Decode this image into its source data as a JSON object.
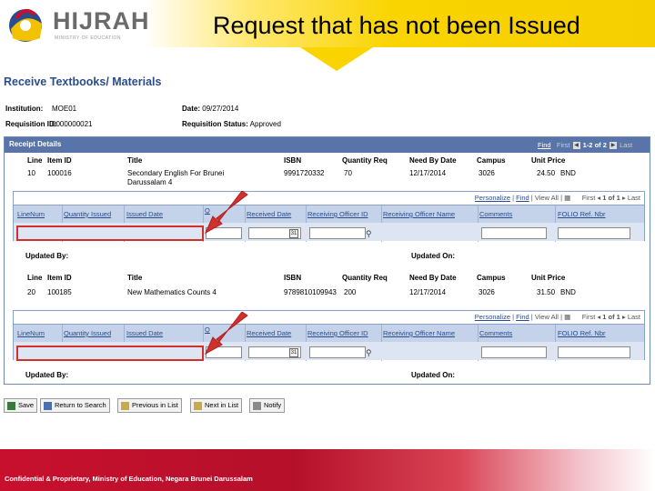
{
  "slide": {
    "logo_text": "HIJRAH",
    "logo_sub": "MINISTRY OF EDUCATION",
    "title": "Request that has not been Issued",
    "footer": "Confidential & Proprietary, Ministry of Education, Negara Brunei Darussalam"
  },
  "page": {
    "heading": "Receive Textbooks/ Materials",
    "institution_label": "Institution:",
    "institution_value": "MOE01",
    "date_label": "Date:",
    "date_value": "09/27/2014",
    "requisition_id_label": "Requisition ID:",
    "requisition_id_value": "0000000021",
    "status_label": "Requisition Status:",
    "status_value": "Approved"
  },
  "receipt": {
    "title": "Receipt Details",
    "nav": {
      "find": "Find",
      "first": "First",
      "count": "1-2 of 2",
      "last": "Last"
    },
    "columns": {
      "line": "Line",
      "item_id": "Item ID",
      "title": "Title",
      "isbn": "ISBN",
      "qty": "Quantity Req",
      "need_by": "Need By Date",
      "campus": "Campus",
      "unit_price": "Unit Price"
    },
    "rows": [
      {
        "line": "10",
        "item_id": "100016",
        "title_line1": "Secondary English For Brunei",
        "title_line2": "Darussalam 4",
        "isbn": "9991720332",
        "qty": "70",
        "need_by": "12/17/2014",
        "campus": "3026",
        "price": "24.50",
        "currency": "BND",
        "updated_by": "Updated By:",
        "updated_on": "Updated On:"
      },
      {
        "line": "20",
        "item_id": "100185",
        "title_line1": "New Mathematics Counts 4",
        "title_line2": "",
        "isbn": "9789810109943",
        "qty": "200",
        "need_by": "12/17/2014",
        "campus": "3026",
        "price": "31.50",
        "currency": "BND",
        "updated_by": "Updated By:",
        "updated_on": "Updated On:"
      }
    ]
  },
  "sub_grid": {
    "personalize": "Personalize",
    "find": "Find",
    "view_all": "View All",
    "first": "First",
    "count": "1 of 1",
    "last": "Last",
    "columns": {
      "line_num": "LineNum",
      "qty_issued": "Quantity Issued",
      "issued_date": "Issued Date",
      "qty_short": "Q",
      "received_date": "Received Date",
      "officer_id": "Receiving Officer ID",
      "officer_name": "Receiving Officer Name",
      "comments": "Comments",
      "folio": "FOLIO Ref. Nbr"
    }
  },
  "buttons": {
    "save": "Save",
    "return": "Return to Search",
    "previous": "Previous in List",
    "next": "Next in List",
    "notify": "Notify"
  },
  "colors": {
    "highlight": "#d0312d",
    "panel_header": "#5874a8",
    "heading": "#2b4c8c"
  }
}
